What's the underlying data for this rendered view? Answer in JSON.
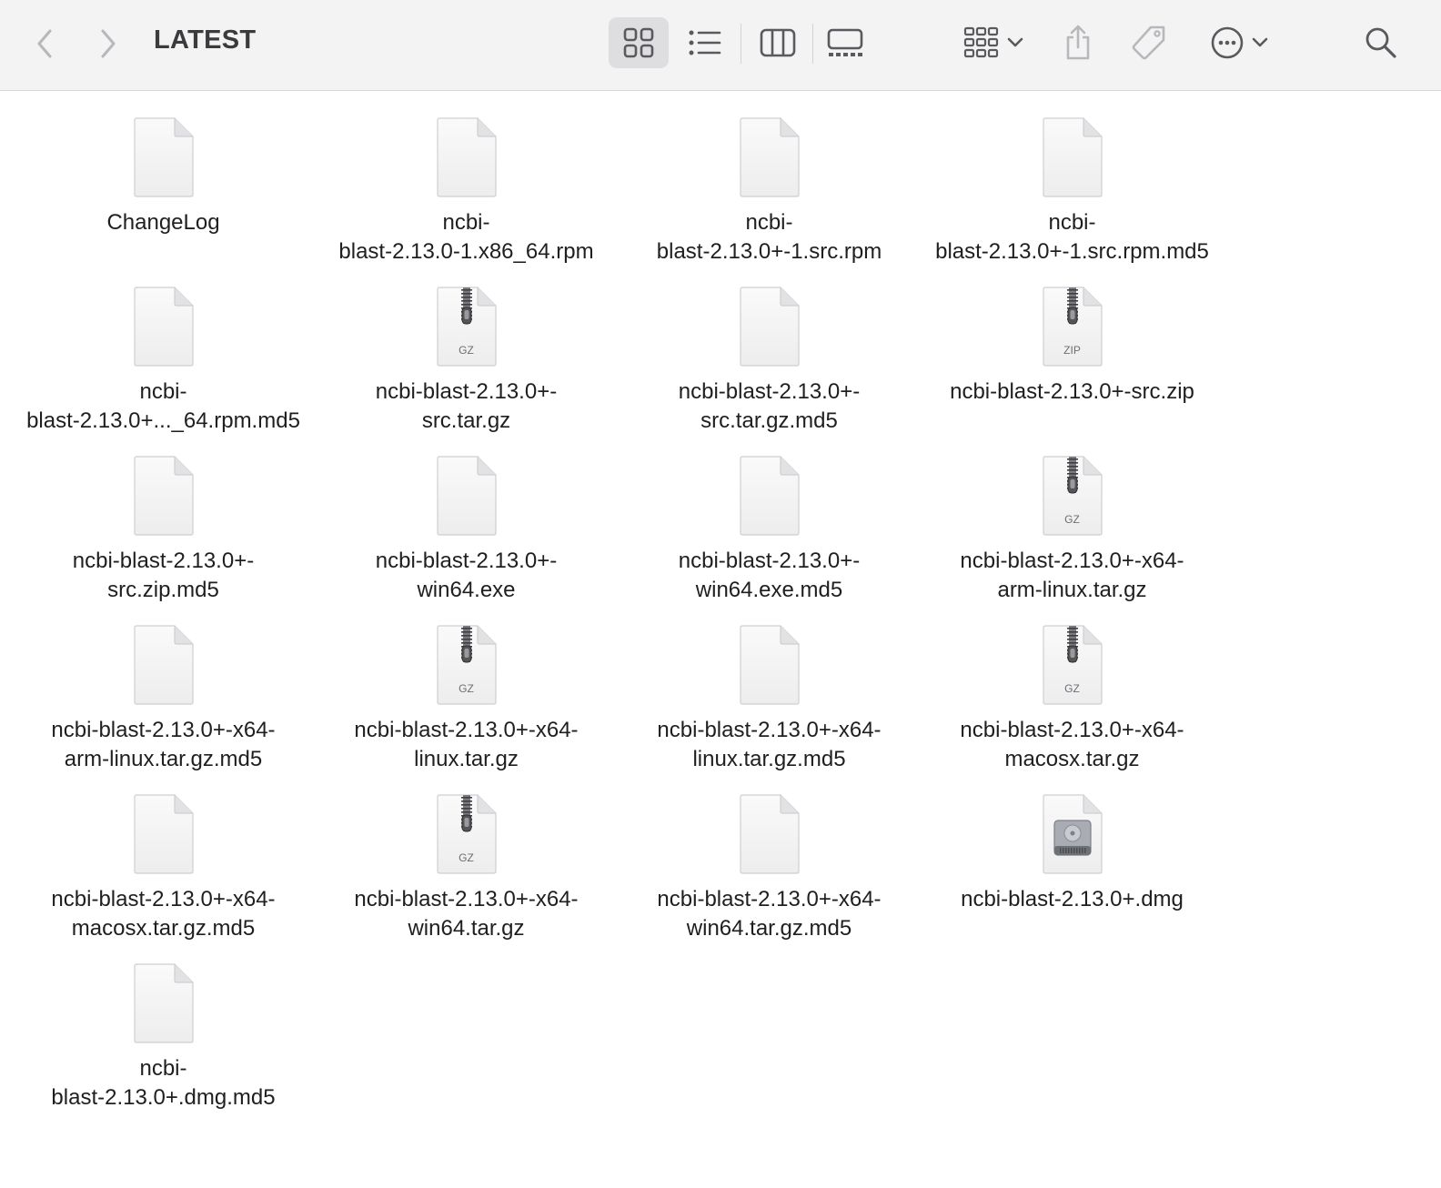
{
  "window": {
    "title": "LATEST",
    "toolbar": {
      "back_icon": "chevron-left-icon",
      "forward_icon": "chevron-right-icon",
      "view_modes": [
        "icon-view",
        "list-view",
        "column-view",
        "gallery-view"
      ],
      "active_view": "icon-view",
      "group_icon": "group-grid-icon",
      "share_icon": "share-icon",
      "tag_icon": "tag-icon",
      "more_icon": "ellipsis-circle-icon",
      "search_icon": "search-icon"
    }
  },
  "colors": {
    "toolbar_bg": "#f3f3f4",
    "active_segment": "#dedee0",
    "icon_gray": "#6e6e73",
    "disabled_gray": "#b8b8bc"
  },
  "files": [
    {
      "name": "ChangeLog",
      "kind": "generic"
    },
    {
      "name": "ncbi-\nblast-2.13.0-1.x86_64.rpm",
      "kind": "generic"
    },
    {
      "name": "ncbi-\nblast-2.13.0+-1.src.rpm",
      "kind": "generic"
    },
    {
      "name": "ncbi-\nblast-2.13.0+-1.src.rpm.md5",
      "kind": "generic"
    },
    {
      "name": "ncbi-\nblast-2.13.0+..._64.rpm.md5",
      "kind": "generic"
    },
    {
      "name": "ncbi-blast-2.13.0+-\nsrc.tar.gz",
      "kind": "archive",
      "badge": "GZ"
    },
    {
      "name": "ncbi-blast-2.13.0+-\nsrc.tar.gz.md5",
      "kind": "generic"
    },
    {
      "name": "ncbi-blast-2.13.0+-src.zip",
      "kind": "archive",
      "badge": "ZIP"
    },
    {
      "name": "ncbi-blast-2.13.0+-\nsrc.zip.md5",
      "kind": "generic"
    },
    {
      "name": "ncbi-blast-2.13.0+-\nwin64.exe",
      "kind": "generic"
    },
    {
      "name": "ncbi-blast-2.13.0+-\nwin64.exe.md5",
      "kind": "generic"
    },
    {
      "name": "ncbi-blast-2.13.0+-x64-\narm-linux.tar.gz",
      "kind": "archive",
      "badge": "GZ"
    },
    {
      "name": "ncbi-blast-2.13.0+-x64-\narm-linux.tar.gz.md5",
      "kind": "generic"
    },
    {
      "name": "ncbi-blast-2.13.0+-x64-\nlinux.tar.gz",
      "kind": "archive",
      "badge": "GZ"
    },
    {
      "name": "ncbi-blast-2.13.0+-x64-\nlinux.tar.gz.md5",
      "kind": "generic"
    },
    {
      "name": "ncbi-blast-2.13.0+-x64-\nmacosx.tar.gz",
      "kind": "archive",
      "badge": "GZ"
    },
    {
      "name": "ncbi-blast-2.13.0+-x64-\nmacosx.tar.gz.md5",
      "kind": "generic"
    },
    {
      "name": "ncbi-blast-2.13.0+-x64-\nwin64.tar.gz",
      "kind": "archive",
      "badge": "GZ"
    },
    {
      "name": "ncbi-blast-2.13.0+-x64-\nwin64.tar.gz.md5",
      "kind": "generic"
    },
    {
      "name": "ncbi-blast-2.13.0+.dmg",
      "kind": "disk-image"
    },
    {
      "name": "ncbi-\nblast-2.13.0+.dmg.md5",
      "kind": "generic"
    }
  ]
}
